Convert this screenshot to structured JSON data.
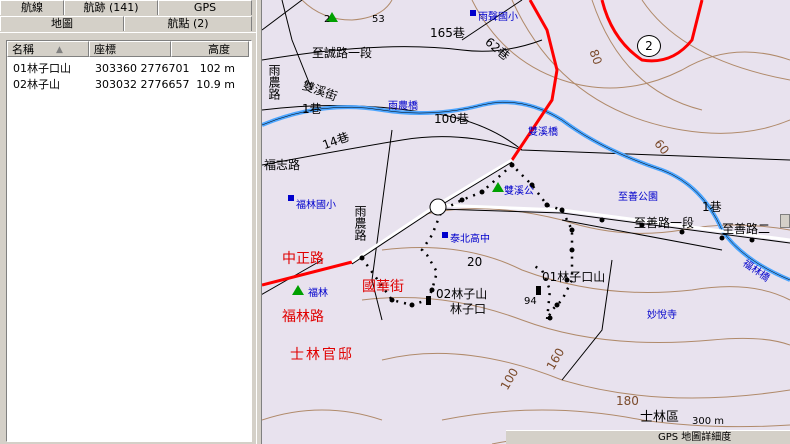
{
  "tabs_top": [
    "航線",
    "航跡 (141)",
    "GPS"
  ],
  "tabs_bottom": [
    "地圖",
    "航點 (2)"
  ],
  "list": {
    "headers": {
      "name": "名稱",
      "coord": "座標",
      "alt": "高度"
    },
    "sort_icon": "sort-ascending-icon",
    "rows": [
      {
        "name": "01林子口山",
        "coord": "303360 2776701",
        "alt": "102 m"
      },
      {
        "name": "02林子山",
        "coord": "303032 2776657",
        "alt": "10.9 m"
      }
    ]
  },
  "map": {
    "roads": {
      "r1": "165巷",
      "r2": "62巷",
      "r3": "至誠路一段",
      "r4": "雙溪街",
      "r5": "雨農路",
      "r6": "100巷",
      "r7": "14巷",
      "r8": "福志路",
      "r9": "至善路一段",
      "r10": "至善路二",
      "r11": "1巷",
      "r12": "雨農路",
      "r13": "20",
      "r14": "1巷"
    },
    "places": {
      "p1": "雨聲國小",
      "p2": "雨農橋",
      "p3": "雙溪橋",
      "p4": "雙溪公",
      "p5": "至善公園",
      "p6": "福林國小",
      "p7": "泰北高中",
      "p8": "福林",
      "p9": "妙悅寺",
      "p10": "福林橋"
    },
    "red_labels": {
      "a": "中正路",
      "b": "福林路",
      "c": "士林官邸",
      "d": "國華街"
    },
    "waypoints": {
      "w1": "01林子口山",
      "w2": "02林子山",
      "w3": "林子口"
    },
    "contours": {
      "c1": "80",
      "c2": "60",
      "c3": "100",
      "c4": "160",
      "c5": "180",
      "c6": "94",
      "c7": "53",
      "c8": "2"
    },
    "route_badge": "2",
    "district": "士林區",
    "scale": "300 m",
    "status": "GPS 地圖詳細度"
  },
  "colors": {
    "highway": "#ff0000",
    "river": "#4da6ff",
    "track": "#000000",
    "accent_red": "#e00000"
  }
}
